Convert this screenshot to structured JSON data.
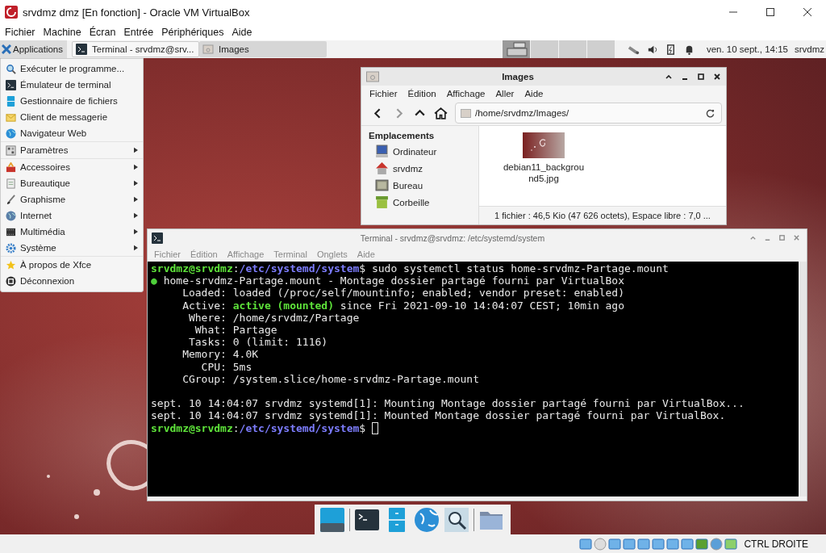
{
  "window": {
    "title": "srvdmz dmz [En fonction] - Oracle VM VirtualBox"
  },
  "menu_bar": [
    "Fichier",
    "Machine",
    "Écran",
    "Entrée",
    "Périphériques",
    "Aide"
  ],
  "panel": {
    "applications": "Applications",
    "tasks": [
      {
        "label": "Terminal - srvdmz@srv...",
        "kind": "terminal",
        "selected": true
      },
      {
        "label": "Images",
        "kind": "folder",
        "selected": false
      }
    ],
    "workspaces": [
      {
        "selected": true
      },
      {
        "selected": false
      },
      {
        "selected": false
      },
      {
        "selected": false
      }
    ],
    "clock": "ven. 10 sept., 14:15",
    "user": "srvdmz"
  },
  "app_menu": {
    "groups": [
      {
        "items": [
          {
            "label": "Exécuter le programme...",
            "kind": "run",
            "submenu": false
          },
          {
            "label": "Émulateur de terminal",
            "kind": "terminal",
            "submenu": false
          },
          {
            "label": "Gestionnaire de fichiers",
            "kind": "files",
            "submenu": false
          },
          {
            "label": "Client de messagerie",
            "kind": "mail",
            "submenu": false
          },
          {
            "label": "Navigateur Web",
            "kind": "web",
            "submenu": false
          }
        ]
      },
      {
        "items": [
          {
            "label": "Paramètres",
            "kind": "settings",
            "submenu": true
          }
        ]
      },
      {
        "items": [
          {
            "label": "Accessoires",
            "kind": "accessories",
            "submenu": true
          },
          {
            "label": "Bureautique",
            "kind": "office",
            "submenu": true
          },
          {
            "label": "Graphisme",
            "kind": "graphics",
            "submenu": true
          },
          {
            "label": "Internet",
            "kind": "internet",
            "submenu": true
          },
          {
            "label": "Multimédia",
            "kind": "multimedia",
            "submenu": true
          },
          {
            "label": "Système",
            "kind": "system",
            "submenu": true
          }
        ]
      },
      {
        "items": [
          {
            "label": "À propos de Xfce",
            "kind": "about",
            "submenu": false
          },
          {
            "label": "Déconnexion",
            "kind": "logout",
            "submenu": false
          }
        ]
      }
    ]
  },
  "file_manager": {
    "title": "Images",
    "menu": [
      "Fichier",
      "Édition",
      "Affichage",
      "Aller",
      "Aide"
    ],
    "path": "/home/srvdmz/Images/",
    "sidebar": {
      "heading": "Emplacements",
      "places": [
        {
          "label": "Ordinateur",
          "kind": "computer"
        },
        {
          "label": "srvdmz",
          "kind": "home"
        },
        {
          "label": "Bureau",
          "kind": "desktop"
        },
        {
          "label": "Corbeille",
          "kind": "trash"
        }
      ]
    },
    "files": [
      {
        "name": "debian11_background5.jpg",
        "kind": "picture"
      }
    ],
    "status": "1 fichier : 46,5 Kio (47 626 octets), Espace libre : 7,0 ..."
  },
  "terminal": {
    "title": "Terminal - srvdmz@srvdmz: /etc/systemd/system",
    "menu": [
      "Fichier",
      "Édition",
      "Affichage",
      "Terminal",
      "Onglets",
      "Aide"
    ],
    "lines": [
      {
        "segments": [
          {
            "text": "srvdmz@srvdmz",
            "kind": "user"
          },
          {
            "text": ":",
            "kind": "plain"
          },
          {
            "text": "/etc/systemd/system",
            "kind": "path"
          },
          {
            "text": "$ sudo systemctl status home-srvdmz-Partage.mount",
            "kind": "plain"
          }
        ]
      },
      {
        "segments": [
          {
            "text": "●",
            "kind": "dot"
          },
          {
            "text": " home-srvdmz-Partage.mount - Montage dossier partagé fourni par VirtualBox",
            "kind": "plain"
          }
        ]
      },
      {
        "segments": [
          {
            "text": "     Loaded: loaded (/proc/self/mountinfo; enabled; vendor preset: enabled)",
            "kind": "plain"
          }
        ]
      },
      {
        "segments": [
          {
            "text": "     Active: ",
            "kind": "plain"
          },
          {
            "text": "active (mounted)",
            "kind": "active"
          },
          {
            "text": " since Fri 2021-09-10 14:04:07 CEST; 10min ago",
            "kind": "plain"
          }
        ]
      },
      {
        "segments": [
          {
            "text": "      Where: /home/srvdmz/Partage",
            "kind": "plain"
          }
        ]
      },
      {
        "segments": [
          {
            "text": "       What: Partage",
            "kind": "plain"
          }
        ]
      },
      {
        "segments": [
          {
            "text": "      Tasks: 0 (limit: 1116)",
            "kind": "plain"
          }
        ]
      },
      {
        "segments": [
          {
            "text": "     Memory: 4.0K",
            "kind": "plain"
          }
        ]
      },
      {
        "segments": [
          {
            "text": "        CPU: 5ms",
            "kind": "plain"
          }
        ]
      },
      {
        "segments": [
          {
            "text": "     CGroup: /system.slice/home-srvdmz-Partage.mount",
            "kind": "plain"
          }
        ]
      },
      {
        "kind": "blank"
      },
      {
        "segments": [
          {
            "text": "sept. 10 14:04:07 srvdmz systemd[1]: Mounting Montage dossier partagé fourni par VirtualBox...",
            "kind": "plain"
          }
        ]
      },
      {
        "segments": [
          {
            "text": "sept. 10 14:04:07 srvdmz systemd[1]: Mounted Montage dossier partagé fourni par VirtualBox.",
            "kind": "plain"
          }
        ]
      },
      {
        "segments": [
          {
            "text": "srvdmz@srvdmz",
            "kind": "user"
          },
          {
            "text": ":",
            "kind": "plain"
          },
          {
            "text": "/etc/systemd/system",
            "kind": "path"
          },
          {
            "text": "$ ",
            "kind": "plain"
          }
        ],
        "cursor": true
      }
    ]
  },
  "host_key": "CTRL DROITE"
}
